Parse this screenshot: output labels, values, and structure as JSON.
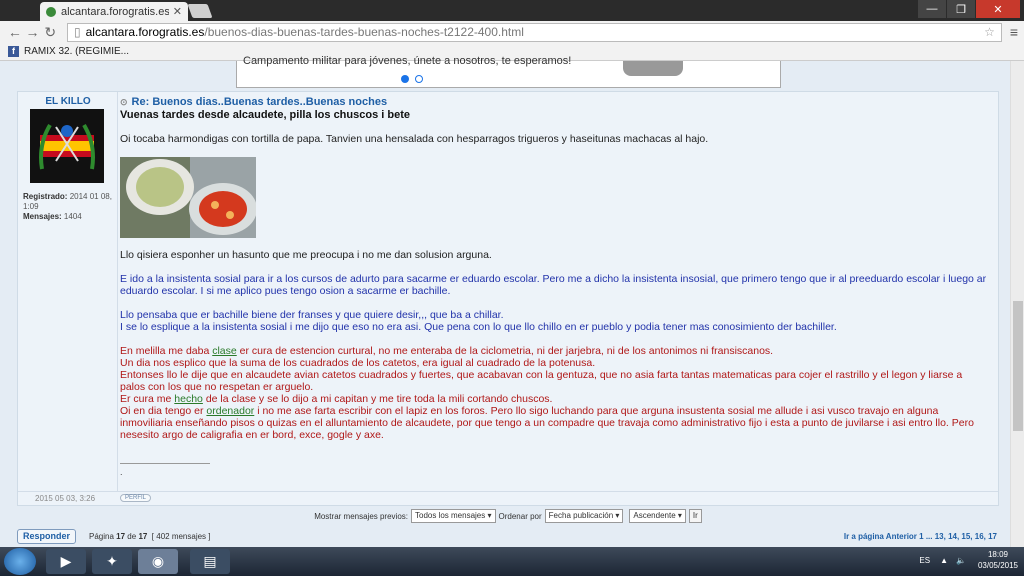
{
  "browser": {
    "tab_title": "alcantara.forogratis.es - V",
    "url_host": "alcantara.forogratis.es",
    "url_path": "/buenos-dias-buenas-tardes-buenas-noches-t2122-400.html",
    "bookmark_label": "RAMIX 32. (REGIMIE..."
  },
  "ad": {
    "text": "Campamento militar para jóvenes, únete a nosotros, te esperamos!"
  },
  "post": {
    "author": "EL KILLO",
    "title": "Re: Buenos dias..Buenas tardes..Buenas noches",
    "registered_label": "Registrado:",
    "registered_value": "2014 01 08, 1:09",
    "messages_label": "Mensajes:",
    "messages_value": "1404",
    "subtitle": "Vuenas tardes desde alcaudete, pilla los chuscos i bete",
    "line1": "Oi tocaba harmondigas con tortilla de papa. Tanvien una hensalada con hesparragos trigueros y haseitunas machacas al hajo.",
    "line2": "Llo qisiera esponher un hasunto que me preocupa i no me dan solusion arguna.",
    "blue1": "E ido a la insistenta sosial para ir a los cursos de adurto para sacarme er eduardo escolar. Pero me a dicho la insistenta insosial, que primero tengo que ir al preeduardo escolar i luego ar eduardo escolar. I si me aplico pues tengo osion a sacarme er bachille.",
    "blue2": "Llo pensaba que er bachille biene der franses y que quiere desir,,, que ba a chillar.",
    "blue3": "I se lo esplique a la insistenta sosial i me dijo que eso no era asi. Que pena con lo que llo chillo en er pueblo y podia tener mas conosimiento der bachiller.",
    "red1_pre": "En melilla me daba",
    "red1_link": "clase",
    "red1_post": "er cura de estencion curtural, no me enteraba de la ciclometria, ni der jarjebra, ni de los antonimos ni fransiscanos.",
    "red2": "Un dia nos esplico que la suma de los cuadrados de los catetos, era igual al cuadrado de la potenusa.",
    "red3": "Entonses llo le dije que en alcaudete avian catetos cuadrados y fuertes, que acabavan con la gentuza, que no asia farta tantas matematicas para cojer el rastrillo y el legon y liarse a palos con los que no respetan er arguelo.",
    "red4_pre": "Er cura me",
    "red4_link": "hecho",
    "red4_post": "de la clase y se lo dijo a mi capitan y me tire toda la mili cortando chuscos.",
    "red5_pre": "Oi en dia tengo er",
    "red5_link": "ordenador",
    "red5_post": "i no me ase farta escribir con el lapiz en los foros. Pero llo sigo luchando para que arguna insustenta sosial me allude i asi vusco travajo en alguna inmoviliaria enseñando pisos o quizas en el alluntamiento de alcaudete, por que tengo a un compadre que travaja como administrativo fijo i esta a punto de juvilarse i asi entro llo. Pero nesesito argo de caligrafia en er bord, exce, gogle y axe.",
    "sig_dot": ".",
    "date": "2015 05 03, 3:26",
    "perfil_label": "PERFIL"
  },
  "sortbar": {
    "prev_label": "Mostrar mensajes previos:",
    "prev_value": "Todos los mensajes",
    "order_label": "Ordenar por",
    "order_value": "Fecha publicación",
    "dir_value": "Ascendente",
    "go_label": "Ir"
  },
  "pagebar": {
    "respond_label": "Responder",
    "page_prefix": "Página",
    "page_current": "17",
    "page_of": "de",
    "page_total": "17",
    "count": "[ 402 mensajes ]",
    "goto_label": "Ir a página Anterior",
    "links": "1 ... 13, 14, 15, 16, 17"
  },
  "taskbar": {
    "lang": "ES",
    "time": "18:09",
    "date": "03/05/2015"
  }
}
